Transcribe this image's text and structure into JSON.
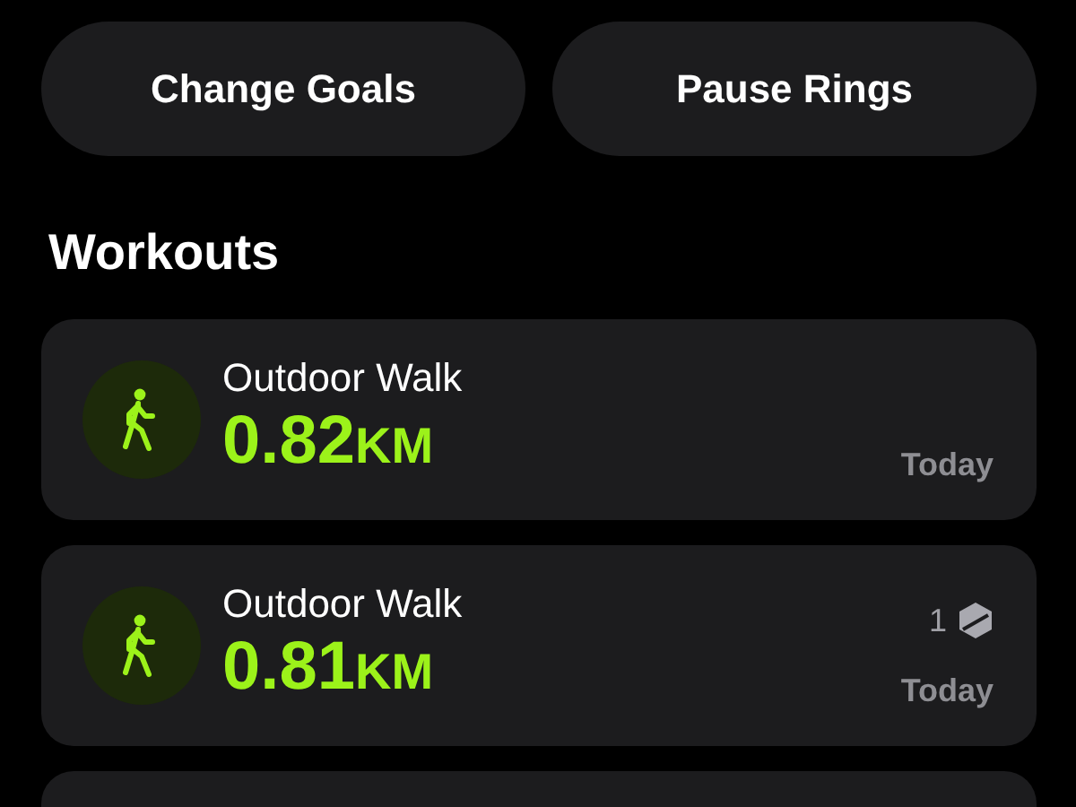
{
  "buttons": [
    "Change Goals",
    "Pause Rings"
  ],
  "section_title": "Workouts",
  "workouts": [
    {
      "name": "Outdoor Walk",
      "value": "0.82",
      "unit": "KM",
      "date": "Today"
    },
    {
      "name": "Outdoor Walk",
      "value": "0.81",
      "unit": "KM",
      "date": "Today",
      "badge": {
        "count": "1"
      }
    }
  ]
}
